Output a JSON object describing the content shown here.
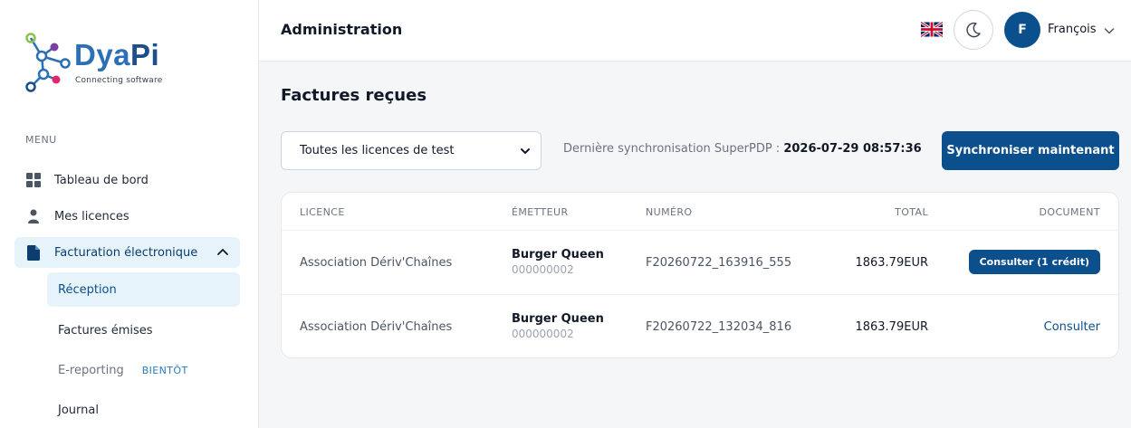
{
  "brand": {
    "name_part1": "Dya",
    "name_part2": "Pi",
    "tagline": "Connecting software"
  },
  "sidebar": {
    "menu_title": "MENU",
    "items": [
      {
        "label": "Tableau de bord",
        "icon": "grid-icon"
      },
      {
        "label": "Mes licences",
        "icon": "user-icon"
      },
      {
        "label": "Facturation électronique",
        "icon": "document-icon",
        "expanded": true
      }
    ],
    "sub_items": [
      {
        "label": "Réception",
        "active": true
      },
      {
        "label": "Factures émises"
      },
      {
        "label": "E-reporting",
        "badge": "BIENTÔT",
        "disabled": true
      },
      {
        "label": "Journal"
      }
    ]
  },
  "header": {
    "title": "Administration",
    "flag_icon": "uk-flag-icon",
    "theme_icon": "moon-icon",
    "user_initial": "F",
    "user_name": "François"
  },
  "main": {
    "title": "Factures reçues",
    "license_select": "Toutes les licences de test",
    "sync_label": "Dernière synchronisation SuperPDP :",
    "sync_time": "2026-07-29 08:57:36",
    "sync_button": "Synchroniser maintenant",
    "table": {
      "headers": [
        "LICENCE",
        "ÉMETTEUR",
        "NUMÉRO",
        "TOTAL",
        "DOCUMENT"
      ],
      "rows": [
        {
          "licence": "Association Dériv'Chaînes",
          "issuer_name": "Burger Queen",
          "issuer_id": "000000002",
          "number": "F20260722_163916_555",
          "total": "1863.79EUR",
          "document": "Consulter (1 crédit)",
          "document_style": "button"
        },
        {
          "licence": "Association Dériv'Chaînes",
          "issuer_name": "Burger Queen",
          "issuer_id": "000000002",
          "number": "F20260722_132034_816",
          "total": "1863.79EUR",
          "document": "Consulter",
          "document_style": "link"
        }
      ]
    }
  },
  "colors": {
    "primary": "#0b4f8c",
    "active_bg": "#e6f3fb",
    "brand_blue": "#2b6fb6"
  }
}
